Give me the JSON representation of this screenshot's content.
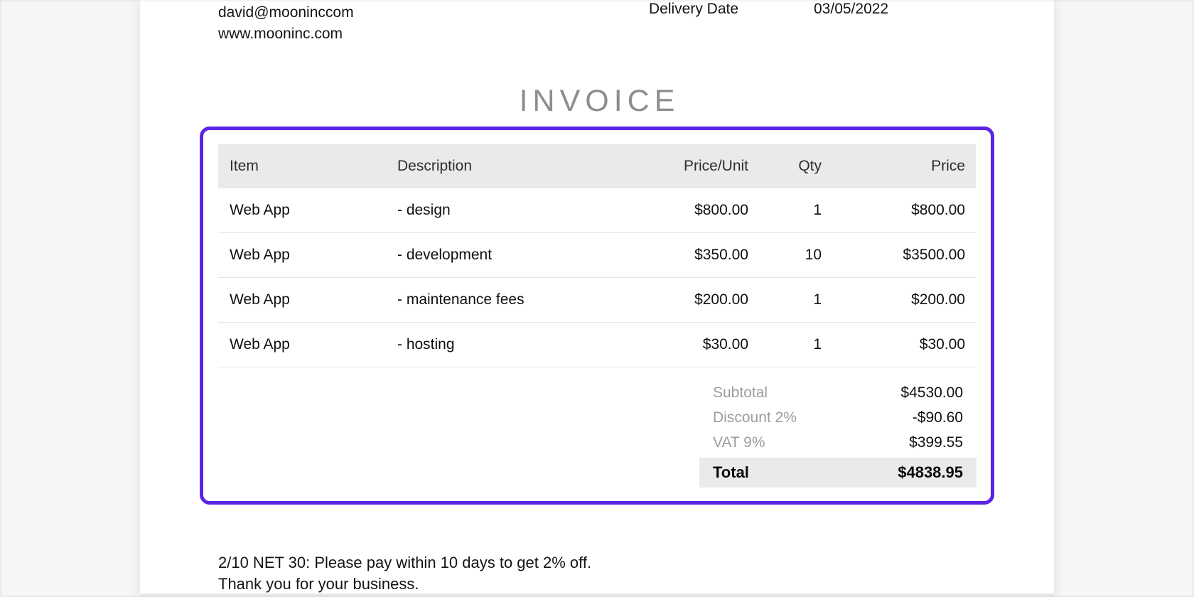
{
  "page": {
    "contact": {
      "email": "david@mooninccom",
      "website": "www.mooninc.com"
    },
    "delivery": {
      "label": "Delivery Date",
      "value": "03/05/2022"
    },
    "title": "INVOICE",
    "table": {
      "columns": [
        "Item",
        "Description",
        "Price/Unit",
        "Qty",
        "Price"
      ],
      "rows": [
        {
          "item": "Web App",
          "description": "- design",
          "price_unit": "$800.00",
          "qty": "1",
          "price": "$800.00"
        },
        {
          "item": "Web App",
          "description": "- development",
          "price_unit": "$350.00",
          "qty": "10",
          "price": "$3500.00"
        },
        {
          "item": "Web App",
          "description": "- maintenance fees",
          "price_unit": "$200.00",
          "qty": "1",
          "price": "$200.00"
        },
        {
          "item": "Web App",
          "description": "- hosting",
          "price_unit": "$30.00",
          "qty": "1",
          "price": "$30.00"
        }
      ]
    },
    "summary": {
      "rows": [
        {
          "label": "Subtotal",
          "value": "$4530.00"
        },
        {
          "label": "Discount 2%",
          "value": "-$90.60"
        },
        {
          "label": "VAT 9%",
          "value": "$399.55"
        }
      ],
      "total": {
        "label": "Total",
        "value": "$4838.95"
      }
    },
    "notes": {
      "line1": "2/10 NET 30: Please pay within 10 days to get 2% off.",
      "line2": "Thank you for your business."
    },
    "colors": {
      "accent": "#5b23e3",
      "band": "#eaeaea",
      "muted": "#9c9c9c",
      "title": "#8d8d8d"
    }
  }
}
